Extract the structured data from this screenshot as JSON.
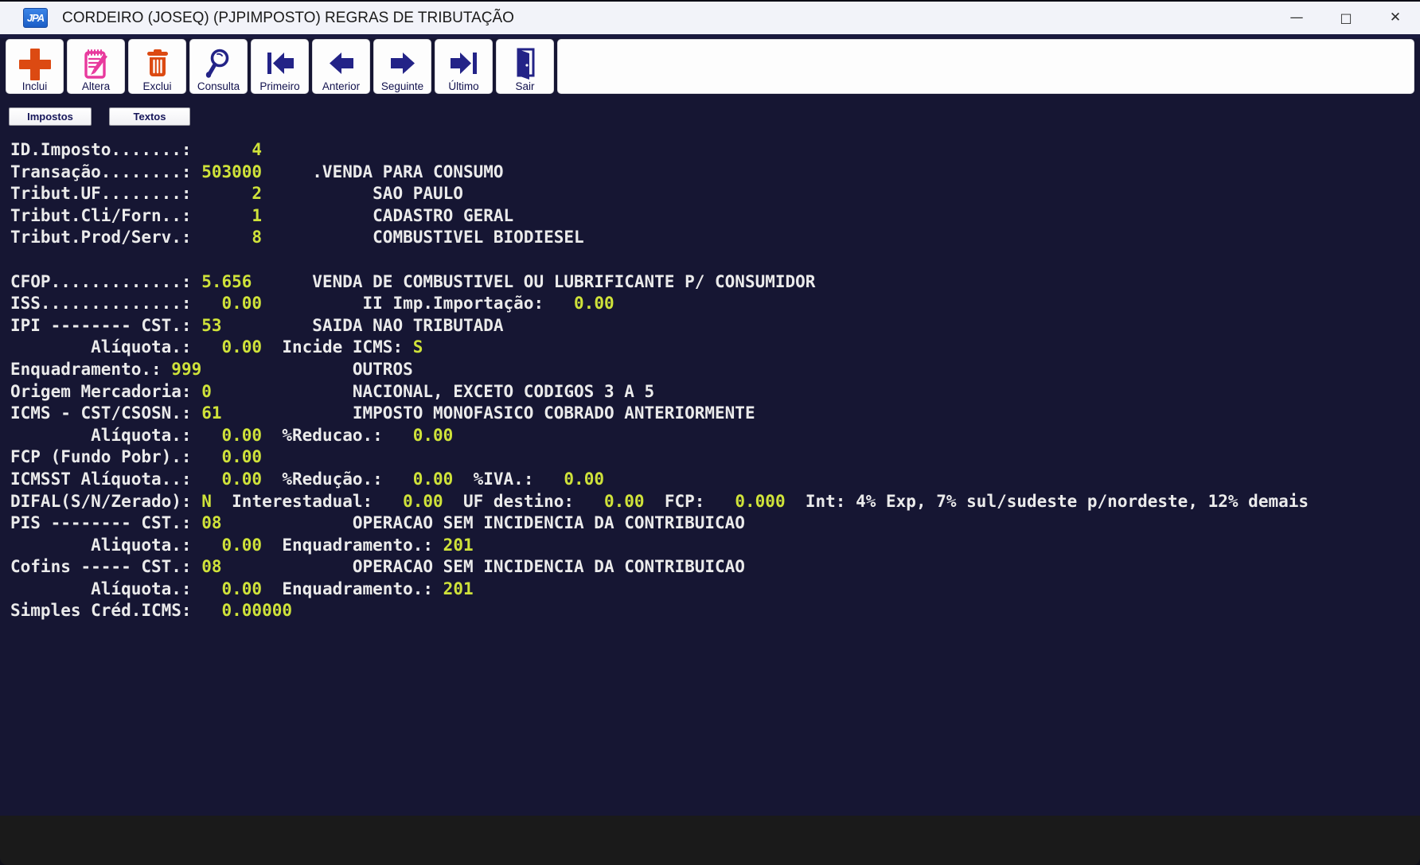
{
  "window": {
    "title": "CORDEIRO (JOSEQ) (PJPIMPOSTO) REGRAS DE TRIBUTAÇÃO",
    "icon_label": "JPA",
    "controls": {
      "minimize_glyph": "—",
      "maximize_glyph": "□",
      "close_glyph": "✕"
    }
  },
  "colors": {
    "terminal_bg": "#161633",
    "terminal_text": "#ebebeb",
    "terminal_value": "#cfe23a",
    "accent_orange": "#dc4a12",
    "accent_pink": "#e8399d",
    "icon_navy": "#232387"
  },
  "toolbar": {
    "buttons": [
      {
        "label": "Inclui",
        "icon": "plus-icon"
      },
      {
        "label": "Altera",
        "icon": "edit-notepad-icon"
      },
      {
        "label": "Exclui",
        "icon": "trash-icon"
      },
      {
        "label": "Consulta",
        "icon": "magnifier-icon"
      },
      {
        "label": "Primeiro",
        "icon": "first-record-icon"
      },
      {
        "label": "Anterior",
        "icon": "previous-record-icon"
      },
      {
        "label": "Seguinte",
        "icon": "next-record-icon"
      },
      {
        "label": "Último",
        "icon": "last-record-icon"
      },
      {
        "label": "Sair",
        "icon": "exit-door-icon"
      }
    ]
  },
  "tabs": [
    {
      "label": "Impostos"
    },
    {
      "label": "Textos"
    }
  ],
  "record": {
    "id_imposto": "4",
    "transacao": "503000",
    "transacao_desc": ".VENDA PARA CONSUMO",
    "tribut_uf": "2",
    "tribut_uf_desc": "SAO PAULO",
    "tribut_cli_forn": "1",
    "tribut_cli_forn_desc": "CADASTRO GERAL",
    "tribut_prod_serv": "8",
    "tribut_prod_serv_desc": "COMBUSTIVEL BIODIESEL",
    "cfop": "5.656",
    "cfop_desc": "VENDA DE COMBUSTIVEL OU LUBRIFICANTE P/ CONSUMIDOR",
    "iss": "0.00",
    "ii_importacao": "0.00",
    "ipi_cst": "53",
    "ipi_cst_desc": "SAIDA NAO TRIBUTADA",
    "ipi_aliquota": "0.00",
    "incide_icms": "S",
    "enquadramento": "999",
    "enquadramento_desc": "OUTROS",
    "origem_mercadoria": "0",
    "origem_mercadoria_desc": "NACIONAL, EXCETO CODIGOS 3 A 5",
    "icms_cst_csosn": "61",
    "icms_cst_csosn_desc": "IMPOSTO MONOFASICO COBRADO ANTERIORMENTE",
    "icms_aliquota": "0.00",
    "icms_reducao": "0.00",
    "fcp_fundo_pobr": "0.00",
    "icmsst_aliquota": "0.00",
    "icmsst_reducao": "0.00",
    "icmsst_iva": "0.00",
    "difal": "N",
    "difal_interestadual": "0.00",
    "difal_uf_destino": "0.00",
    "difal_fcp": "0.000",
    "difal_info": "Int: 4% Exp, 7% sul/sudeste p/nordeste, 12% demais",
    "pis_cst": "08",
    "pis_cst_desc": "OPERACAO SEM INCIDENCIA DA CONTRIBUICAO",
    "pis_aliquota": "0.00",
    "pis_enquadramento": "201",
    "cofins_cst": "08",
    "cofins_cst_desc": "OPERACAO SEM INCIDENCIA DA CONTRIBUICAO",
    "cofins_aliquota": "0.00",
    "cofins_enquadramento": "201",
    "simples_cred_icms": "0.00000"
  },
  "terminal": {
    "lines": [
      [
        {
          "t": "ID.Imposto.......:",
          "c": "w"
        },
        {
          "t": "      4",
          "c": "y"
        }
      ],
      [
        {
          "t": "Transação........: ",
          "c": "w"
        },
        {
          "t": "503000",
          "c": "y"
        },
        {
          "t": "     .VENDA PARA CONSUMO",
          "c": "w"
        }
      ],
      [
        {
          "t": "Tribut.UF........:",
          "c": "w"
        },
        {
          "t": "      2",
          "c": "y"
        },
        {
          "t": "           SAO PAULO",
          "c": "w"
        }
      ],
      [
        {
          "t": "Tribut.Cli/Forn..:",
          "c": "w"
        },
        {
          "t": "      1",
          "c": "y"
        },
        {
          "t": "           CADASTRO GERAL",
          "c": "w"
        }
      ],
      [
        {
          "t": "Tribut.Prod/Serv.:",
          "c": "w"
        },
        {
          "t": "      8",
          "c": "y"
        },
        {
          "t": "           COMBUSTIVEL BIODIESEL",
          "c": "w"
        }
      ],
      [],
      [
        {
          "t": "CFOP.............: ",
          "c": "w"
        },
        {
          "t": "5.656",
          "c": "y"
        },
        {
          "t": "      VENDA DE COMBUSTIVEL OU LUBRIFICANTE P/ CONSUMIDOR",
          "c": "w"
        }
      ],
      [
        {
          "t": "ISS..............:",
          "c": "w"
        },
        {
          "t": "   0.00",
          "c": "y"
        },
        {
          "t": "          II Imp.Importação:",
          "c": "w"
        },
        {
          "t": "   0.00",
          "c": "y"
        }
      ],
      [
        {
          "t": "IPI -------- CST.: ",
          "c": "w"
        },
        {
          "t": "53",
          "c": "y"
        },
        {
          "t": "         SAIDA NAO TRIBUTADA",
          "c": "w"
        }
      ],
      [
        {
          "t": "        Alíquota.:",
          "c": "w"
        },
        {
          "t": "   0.00",
          "c": "y"
        },
        {
          "t": "  Incide ICMS: ",
          "c": "w"
        },
        {
          "t": "S",
          "c": "y"
        }
      ],
      [
        {
          "t": "Enquadramento.: ",
          "c": "w"
        },
        {
          "t": "999",
          "c": "y"
        },
        {
          "t": "               OUTROS",
          "c": "w"
        }
      ],
      [
        {
          "t": "Origem Mercadoria: ",
          "c": "w"
        },
        {
          "t": "0",
          "c": "y"
        },
        {
          "t": "              NACIONAL, EXCETO CODIGOS 3 A 5",
          "c": "w"
        }
      ],
      [
        {
          "t": "ICMS - CST/CSOSN.: ",
          "c": "w"
        },
        {
          "t": "61",
          "c": "y"
        },
        {
          "t": "             IMPOSTO MONOFASICO COBRADO ANTERIORMENTE",
          "c": "w"
        }
      ],
      [
        {
          "t": "        Alíquota.:",
          "c": "w"
        },
        {
          "t": "   0.00",
          "c": "y"
        },
        {
          "t": "  %Reducao.:",
          "c": "w"
        },
        {
          "t": "   0.00",
          "c": "y"
        }
      ],
      [
        {
          "t": "FCP (Fundo Pobr).:",
          "c": "w"
        },
        {
          "t": "   0.00",
          "c": "y"
        }
      ],
      [
        {
          "t": "ICMSST Alíquota..:",
          "c": "w"
        },
        {
          "t": "   0.00",
          "c": "y"
        },
        {
          "t": "  %Redução.:",
          "c": "w"
        },
        {
          "t": "   0.00",
          "c": "y"
        },
        {
          "t": "  %IVA.:",
          "c": "w"
        },
        {
          "t": "   0.00",
          "c": "y"
        }
      ],
      [
        {
          "t": "DIFAL(S/N/Zerado): ",
          "c": "w"
        },
        {
          "t": "N",
          "c": "y"
        },
        {
          "t": "  Interestadual:",
          "c": "w"
        },
        {
          "t": "   0.00",
          "c": "y"
        },
        {
          "t": "  UF destino:",
          "c": "w"
        },
        {
          "t": "   0.00",
          "c": "y"
        },
        {
          "t": "  FCP:",
          "c": "w"
        },
        {
          "t": "   0.000",
          "c": "y"
        },
        {
          "t": "  Int: 4% Exp, 7% sul/sudeste p/nordeste, 12% demais",
          "c": "w"
        }
      ],
      [
        {
          "t": "PIS -------- CST.: ",
          "c": "w"
        },
        {
          "t": "08",
          "c": "y"
        },
        {
          "t": "             OPERACAO SEM INCIDENCIA DA CONTRIBUICAO",
          "c": "w"
        }
      ],
      [
        {
          "t": "        Aliquota.:",
          "c": "w"
        },
        {
          "t": "   0.00",
          "c": "y"
        },
        {
          "t": "  Enquadramento.: ",
          "c": "w"
        },
        {
          "t": "201",
          "c": "y"
        }
      ],
      [
        {
          "t": "Cofins ----- CST.: ",
          "c": "w"
        },
        {
          "t": "08",
          "c": "y"
        },
        {
          "t": "             OPERACAO SEM INCIDENCIA DA CONTRIBUICAO",
          "c": "w"
        }
      ],
      [
        {
          "t": "        Alíquota.:",
          "c": "w"
        },
        {
          "t": "   0.00",
          "c": "y"
        },
        {
          "t": "  Enquadramento.: ",
          "c": "w"
        },
        {
          "t": "201",
          "c": "y"
        }
      ],
      [
        {
          "t": "Simples Créd.ICMS:",
          "c": "w"
        },
        {
          "t": "   0.00000",
          "c": "y"
        }
      ]
    ]
  }
}
